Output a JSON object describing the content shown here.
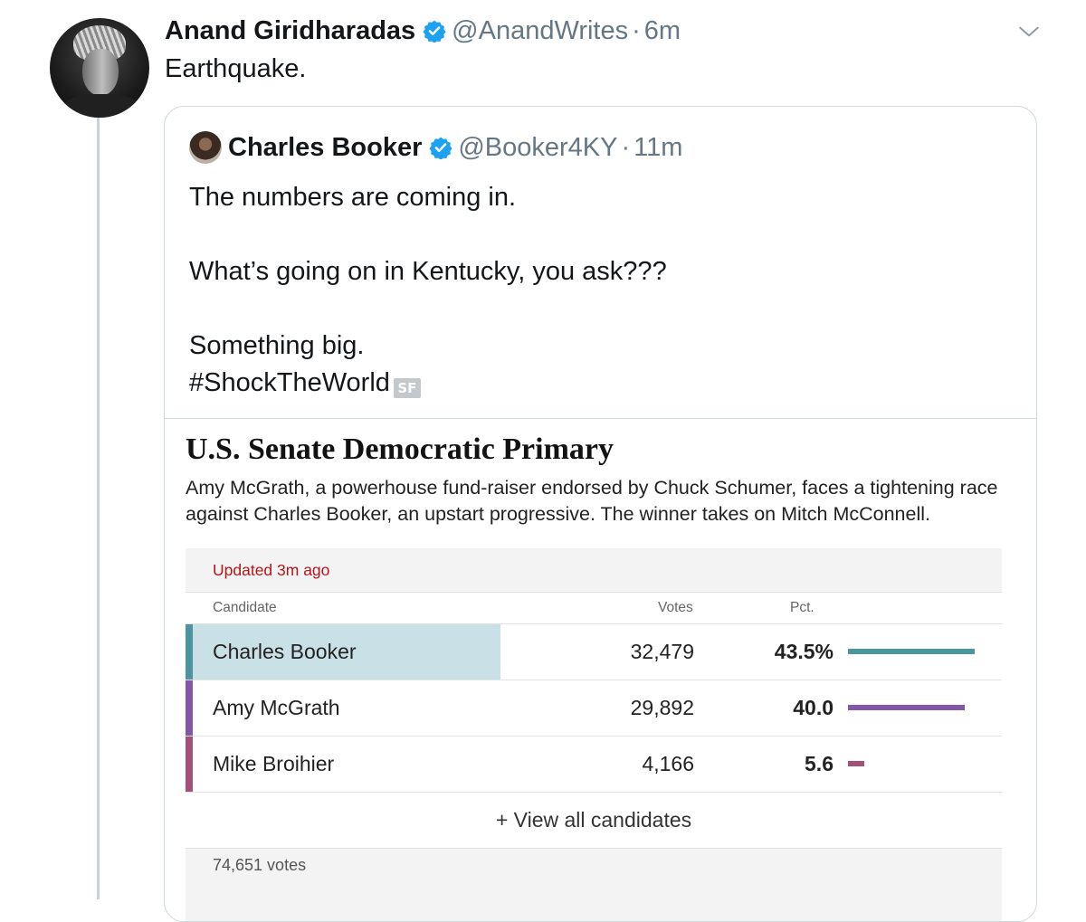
{
  "tweet": {
    "author_name": "Anand Giridharadas",
    "handle": "@AnandWrites",
    "separator": "·",
    "time": "6m",
    "text": "Earthquake."
  },
  "quoted_tweet": {
    "author_name": "Charles Booker",
    "handle": "@Booker4KY",
    "separator": "·",
    "time": "11m",
    "line1": "The numbers are coming in.",
    "line2": "What’s going on in Kentucky, you ask???",
    "line3": "Something big.",
    "line4": "#ShockTheWorld",
    "badge": "SF"
  },
  "results_card": {
    "headline": "U.S. Senate Democratic Primary",
    "subhead": "Amy McGrath, a powerhouse fund-raiser endorsed by Chuck Schumer, faces a tightening race against Charles Booker, an upstart progressive. The winner takes on Mitch McConnell.",
    "updated": "Updated 3m ago",
    "col_candidate": "Candidate",
    "col_votes": "Votes",
    "col_pct": "Pct.",
    "rows": [
      {
        "name": "Charles Booker",
        "votes": "32,479",
        "pct": "43.5%",
        "pct_value": 43.5,
        "color": "#4b95a1",
        "leader": true
      },
      {
        "name": "Amy McGrath",
        "votes": "29,892",
        "pct": "40.0",
        "pct_value": 40.0,
        "color": "#8456a9",
        "leader": false
      },
      {
        "name": "Mike Broihier",
        "votes": "4,166",
        "pct": "5.6",
        "pct_value": 5.6,
        "color": "#a44f78",
        "leader": false
      }
    ],
    "view_all": "+ View all candidates",
    "total_votes": "74,651 votes"
  },
  "colors": {
    "verified": "#1da1f2",
    "updated_red": "#b3161b"
  }
}
